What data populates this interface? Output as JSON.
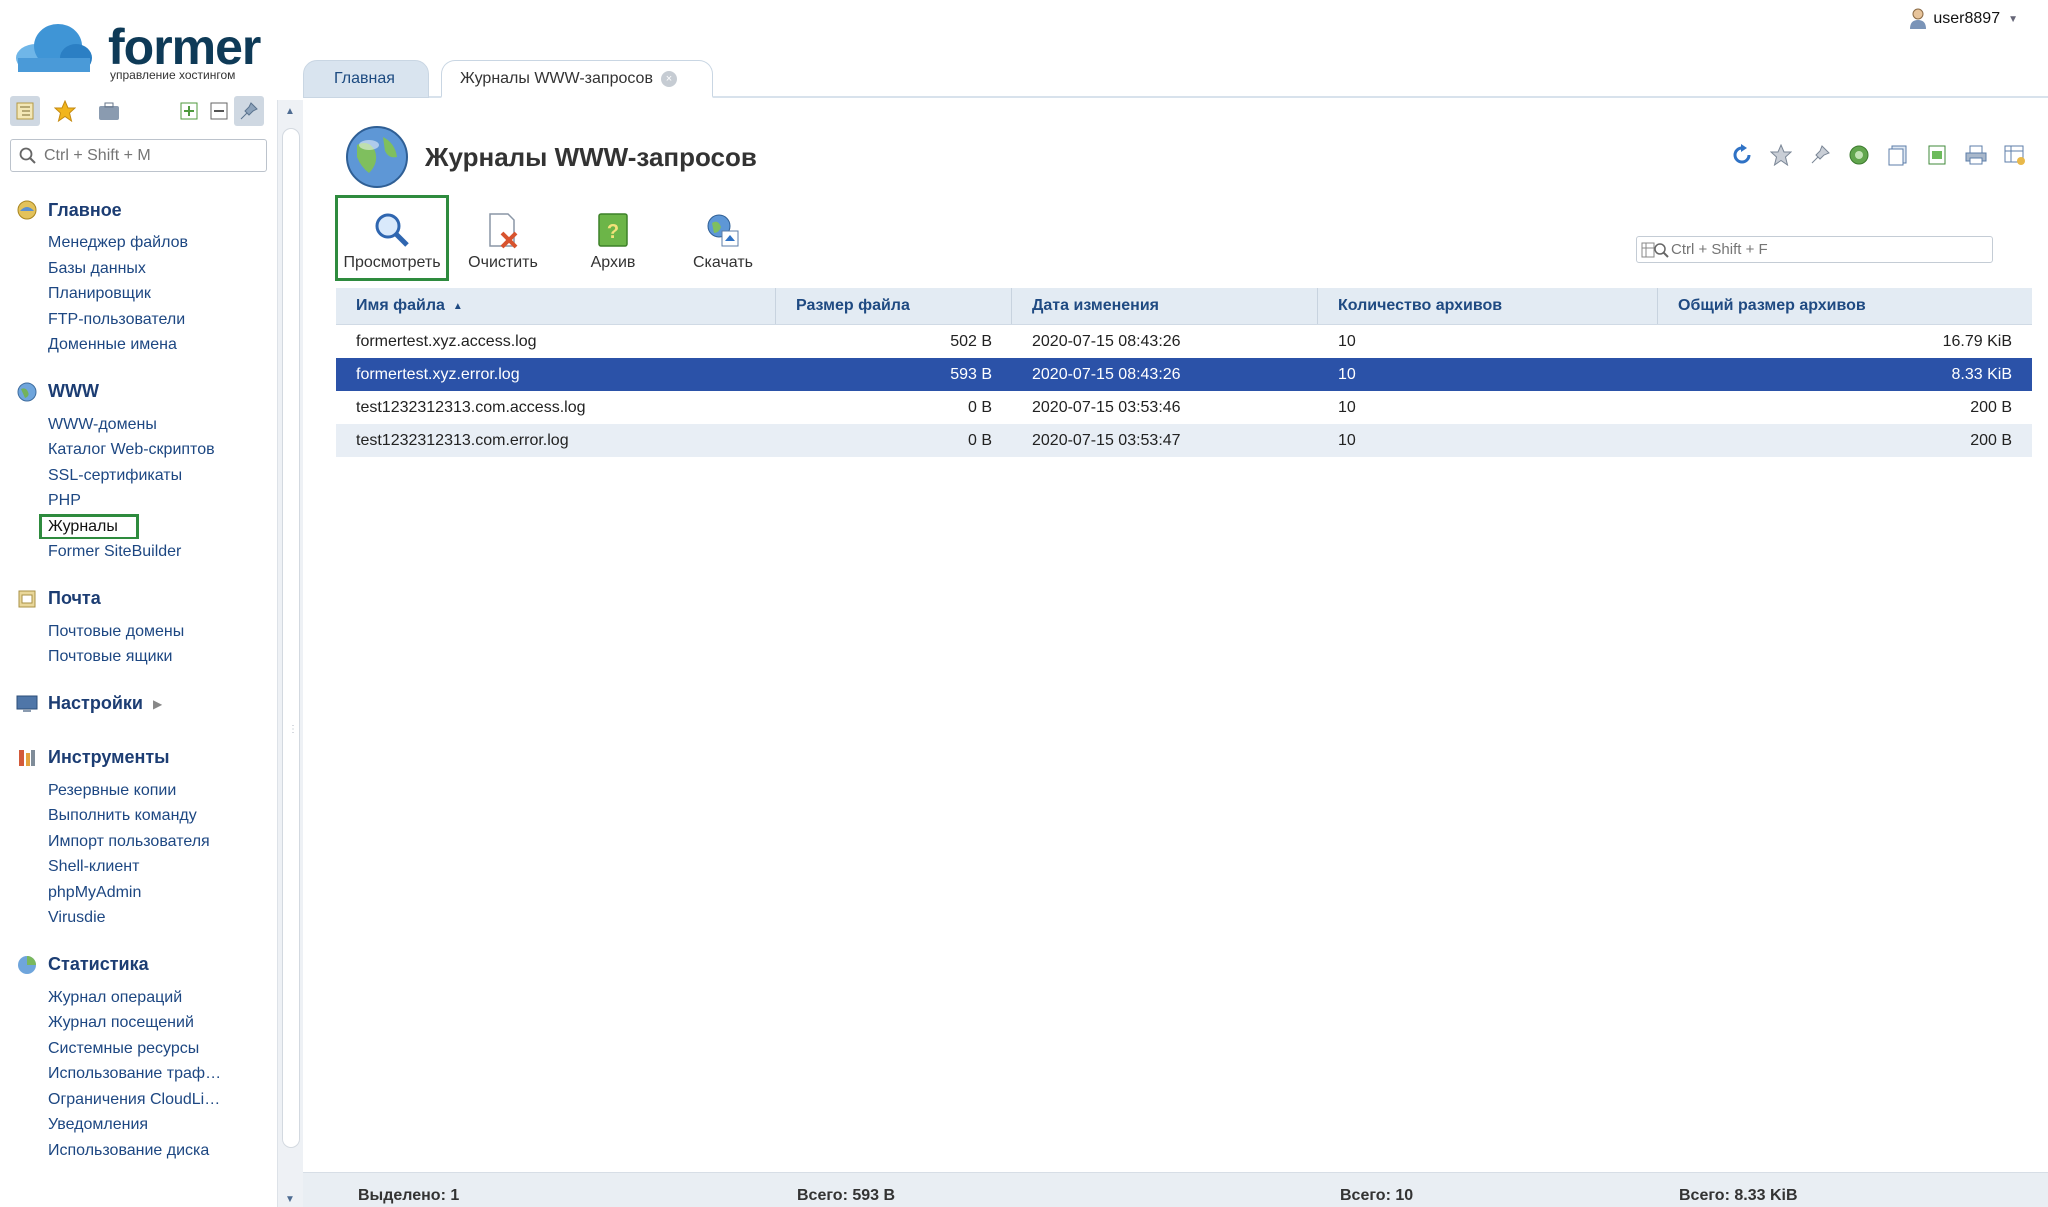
{
  "brand": {
    "name": "former",
    "tagline": "управление хостингом"
  },
  "user": {
    "name": "user8897"
  },
  "side_search": {
    "placeholder": "Ctrl + Shift + M"
  },
  "nav": [
    {
      "label": "Главное",
      "icon": "home-icon",
      "items": [
        "Менеджер файлов",
        "Базы данных",
        "Планировщик",
        "FTP-пользователи",
        "Доменные имена"
      ]
    },
    {
      "label": "WWW",
      "icon": "www-icon",
      "items": [
        "WWW-домены",
        "Каталог Web-скриптов",
        "SSL-сертификаты",
        "PHP",
        "Журналы",
        "Former SiteBuilder"
      ]
    },
    {
      "label": "Почта",
      "icon": "mail-icon",
      "items": [
        "Почтовые домены",
        "Почтовые ящики"
      ]
    },
    {
      "label": "Настройки",
      "icon": "settings-icon",
      "items": []
    },
    {
      "label": "Инструменты",
      "icon": "tools-icon",
      "items": [
        "Резервные копии",
        "Выполнить команду",
        "Импорт пользователя",
        "Shell-клиент",
        "phpMyAdmin",
        "Virusdie"
      ]
    },
    {
      "label": "Статистика",
      "icon": "stats-icon",
      "items": [
        "Журнал операций",
        "Журнал посещений",
        "Системные ресурсы",
        "Использование траф…",
        "Ограничения CloudLi…",
        "Уведомления",
        "Использование диска"
      ]
    }
  ],
  "tabs": {
    "home": "Главная",
    "current": "Журналы WWW-запросов"
  },
  "page": {
    "title": "Журналы WWW-запросов"
  },
  "actions": {
    "view": "Просмотреть",
    "clear": "Очистить",
    "archive": "Архив",
    "download": "Скачать"
  },
  "grid_search": {
    "placeholder": "Ctrl + Shift + F"
  },
  "table": {
    "columns": [
      "Имя файла",
      "Размер файла",
      "Дата изменения",
      "Количество архивов",
      "Общий размер архивов"
    ],
    "rows": [
      [
        "formertest.xyz.access.log",
        "502 B",
        "2020-07-15 08:43:26",
        "10",
        "16.79 KiB"
      ],
      [
        "formertest.xyz.error.log",
        "593 B",
        "2020-07-15 08:43:26",
        "10",
        "8.33 KiB"
      ],
      [
        "test1232312313.com.access.log",
        "0 B",
        "2020-07-15 03:53:46",
        "10",
        "200 B"
      ],
      [
        "test1232312313.com.error.log",
        "0 B",
        "2020-07-15 03:53:47",
        "10",
        "200 B"
      ]
    ]
  },
  "footer": {
    "selected": "Выделено: 1",
    "total_size": "Всего: 593 B",
    "total_count": "Всего: 10",
    "total_archive": "Всего: 8.33 KiB"
  },
  "colors": {
    "selection": "#2b52a8",
    "highlight": "#2e8b3e",
    "nav_text": "#1d4782"
  }
}
